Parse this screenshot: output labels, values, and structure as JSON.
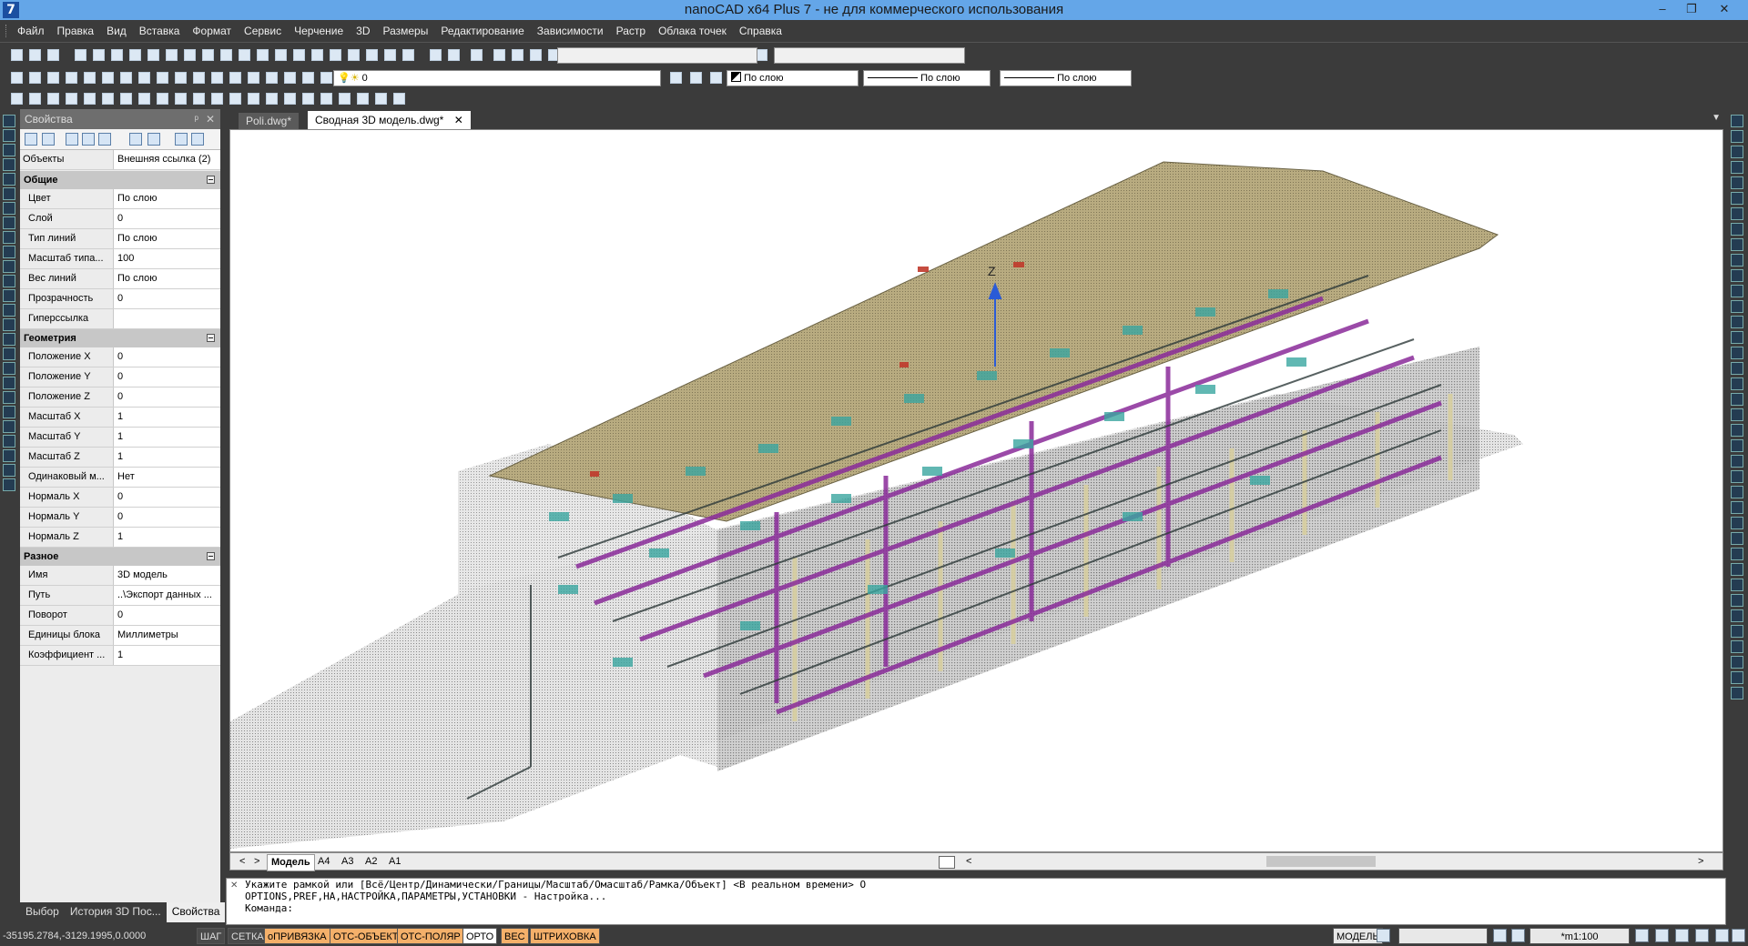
{
  "titlebar": {
    "app_icon": "7",
    "title": "nanoCAD x64 Plus 7 - не для коммерческого использования",
    "min": "–",
    "restore": "❐",
    "close": "✕"
  },
  "menu": [
    "Файл",
    "Правка",
    "Вид",
    "Вставка",
    "Формат",
    "Сервис",
    "Черчение",
    "3D",
    "Размеры",
    "Редактирование",
    "Зависимости",
    "Растр",
    "Облака точек",
    "Справка"
  ],
  "toolbar": {
    "layer_value": "0",
    "color_value": "По слою",
    "linetype_value": "По слою",
    "lineweight_value": "По слою"
  },
  "properties": {
    "title": "Свойства",
    "pin": "ᵖ",
    "close": "✕",
    "objects_label": "Объекты",
    "objects_value": "Внешняя ссылка (2)",
    "general": {
      "title": "Общие",
      "rows": [
        {
          "k": "Цвет",
          "v": "По слою"
        },
        {
          "k": "Слой",
          "v": "0"
        },
        {
          "k": "Тип линий",
          "v": "По слою"
        },
        {
          "k": "Масштаб типа...",
          "v": "100"
        },
        {
          "k": "Вес линий",
          "v": "По слою"
        },
        {
          "k": "Прозрачность",
          "v": "0"
        },
        {
          "k": "Гиперссылка",
          "v": ""
        }
      ]
    },
    "geometry": {
      "title": "Геометрия",
      "rows": [
        {
          "k": "Положение X",
          "v": "0"
        },
        {
          "k": "Положение Y",
          "v": "0"
        },
        {
          "k": "Положение Z",
          "v": "0"
        },
        {
          "k": "Масштаб X",
          "v": "1"
        },
        {
          "k": "Масштаб Y",
          "v": "1"
        },
        {
          "k": "Масштаб Z",
          "v": "1"
        },
        {
          "k": "Одинаковый м...",
          "v": "Нет"
        },
        {
          "k": "Нормаль X",
          "v": "0"
        },
        {
          "k": "Нормаль Y",
          "v": "0"
        },
        {
          "k": "Нормаль Z",
          "v": "1"
        }
      ]
    },
    "misc": {
      "title": "Разное",
      "rows": [
        {
          "k": "Имя",
          "v": "3D модель"
        },
        {
          "k": "Путь",
          "v": "..\\Экспорт данных ..."
        },
        {
          "k": "Поворот",
          "v": "0"
        },
        {
          "k": "Единицы блока",
          "v": "Миллиметры"
        },
        {
          "k": "Коэффициент ...",
          "v": "1"
        }
      ]
    }
  },
  "panel_tabs": [
    "Выбор",
    "История 3D Пос...",
    "Свойства"
  ],
  "doc_tabs": [
    {
      "label": "Poli.dwg*"
    },
    {
      "label": "Сводная 3D модель.dwg*",
      "close": "✕"
    }
  ],
  "layout_tabs": {
    "prev": "<",
    "next": ">",
    "tabs": [
      "Модель",
      "A4",
      "A3",
      "A2",
      "A1"
    ],
    "scroll_left": "<",
    "scroll_right": ">"
  },
  "axis_label": "Z",
  "command": {
    "line1": "Укажите рамкой или [Всё/Центр/Динамически/Границы/Масштаб/Омасштаб/Рамка/Объект] <В реальном времени> О",
    "line2": "OPTIONS,PREF,НА,НАСТРОЙКА,ПАРАМЕТРЫ,УСТАНОВКИ - Настройка...",
    "prompt": "Команда:"
  },
  "status": {
    "coords": "-35195.2784,-3129.1995,0.0000",
    "buttons": [
      {
        "label": "ШАГ",
        "state": "off"
      },
      {
        "label": "СЕТКА",
        "state": "off"
      },
      {
        "label": "оПРИВЯЗКА",
        "state": "on"
      },
      {
        "label": "ОТС-ОБЪЕКТ",
        "state": "on"
      },
      {
        "label": "ОТС-ПОЛЯР",
        "state": "on"
      },
      {
        "label": "ОРТО",
        "state": "white"
      },
      {
        "label": "ВЕС",
        "state": "on"
      },
      {
        "label": "ШТРИХОВКА",
        "state": "on"
      }
    ],
    "model_label": "МОДЕЛЬ",
    "scale": "*m1:100"
  },
  "colors": {
    "accent": "#64a6e8",
    "dark_ui": "#3b3b3b",
    "toggle_on": "#f4b06a",
    "roof": "#b5a77a",
    "pipes_magenta": "#8a2b9a",
    "ducts_cyan": "#3aa6a0"
  }
}
